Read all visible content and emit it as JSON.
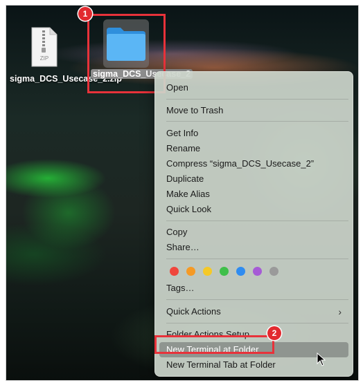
{
  "desktop": {
    "zip_file": {
      "icon_text": "ZIP",
      "label": "sigma_DCS_Usecase_2.zip"
    },
    "folder": {
      "label": "sigma_DCS_Usecase_2",
      "color": "#4aa9f0"
    }
  },
  "annotations": {
    "badge1": "1",
    "badge2": "2",
    "color": "#e8323a"
  },
  "context_menu": {
    "open": "Open",
    "move_to_trash": "Move to Trash",
    "get_info": "Get Info",
    "rename": "Rename",
    "compress": "Compress “sigma_DCS_Usecase_2”",
    "duplicate": "Duplicate",
    "make_alias": "Make Alias",
    "quick_look": "Quick Look",
    "copy": "Copy",
    "share": "Share…",
    "tag_colors": [
      "#f0463c",
      "#f59a25",
      "#f5c927",
      "#3fbf4a",
      "#2f8cf0",
      "#a65bd6",
      "#9a9a9a"
    ],
    "tags": "Tags…",
    "quick_actions": "Quick Actions",
    "folder_actions_setup": "Folder Actions Setup…",
    "new_terminal_at_folder": "New Terminal at Folder",
    "new_terminal_tab_at_folder": "New Terminal Tab at Folder"
  }
}
